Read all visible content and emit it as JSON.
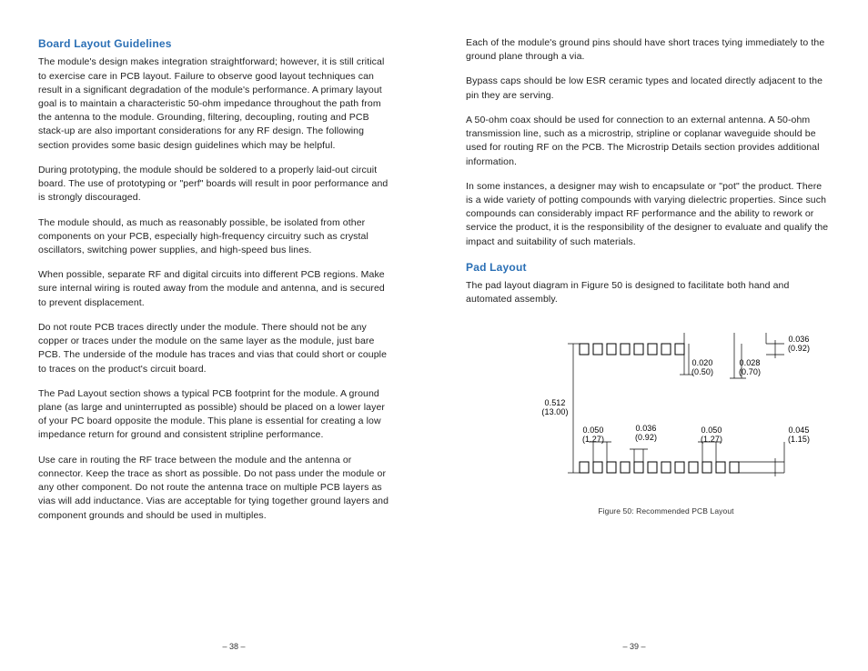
{
  "left": {
    "h1": "Board Layout Guidelines",
    "p1": "The module's design makes integration straightforward; however, it is still critical to exercise care in PCB layout. Failure to observe good layout techniques can result in a significant degradation of the module's performance. A primary layout goal is to maintain a characteristic 50-ohm impedance throughout the path from the antenna to the module. Grounding, filtering, decoupling, routing and PCB stack-up are also important considerations for any RF design. The following section provides some basic design guidelines which may be helpful.",
    "p2": "During prototyping, the module should be soldered to a properly laid-out circuit board. The use of prototyping or \"perf\" boards will result in poor performance and is strongly discouraged.",
    "p3": "The module should, as much as reasonably possible, be isolated from other components on your PCB, especially high-frequency circuitry such as crystal oscillators, switching power supplies, and high-speed bus lines.",
    "p4": "When possible, separate RF and digital circuits into different PCB regions. Make sure internal wiring is routed away from the module and antenna, and is secured to prevent displacement.",
    "p5": "Do not route PCB traces directly under the module. There should not be any copper or traces under the module on the same layer as the module, just bare PCB. The underside of the module has traces and vias that could short or couple to traces on the product's circuit board.",
    "p6": "The Pad Layout section shows a typical PCB footprint for the module. A ground plane (as large and uninterrupted as possible) should be placed on a lower layer of your PC board opposite the module. This plane is essential for creating a low impedance return for ground and consistent stripline performance.",
    "p7": "Use care in routing the RF trace between the module and the antenna or connector. Keep the trace as short as possible. Do not pass under the module or any other component. Do not route the antenna trace on multiple PCB layers as vias will add inductance. Vias are acceptable for tying together ground layers and component grounds and should be used in multiples.",
    "pagenum": "– 38 –"
  },
  "right": {
    "p1": "Each of the module's ground pins should have short traces tying immediately to the ground plane through a via.",
    "p2": "Bypass caps should be low ESR ceramic types and located directly adjacent to the pin they are serving.",
    "p3": "A 50-ohm coax should be used for connection to an external antenna. A 50-ohm transmission line, such as a microstrip, stripline or coplanar waveguide should be used for routing RF on the PCB. The Microstrip Details section provides additional information.",
    "p4": "In some instances, a designer may wish to encapsulate or \"pot\" the product. There is a wide variety of potting compounds with varying dielectric properties. Since such compounds can considerably impact RF performance and the ability to rework or service the product, it is the responsibility of the designer to evaluate and qualify the impact and suitability of such materials.",
    "h2": "Pad Layout",
    "p5": "The pad layout diagram in Figure 50 is designed to facilitate both hand and automated assembly.",
    "figcap": "Figure 50: Recommended PCB Layout",
    "pagenum": "– 39 –"
  },
  "dims": {
    "d1a": "0.020",
    "d1b": "(0.50)",
    "d2a": "0.028",
    "d2b": "(0.70)",
    "d3a": "0.036",
    "d3b": "(0.92)",
    "d4a": "0.512",
    "d4b": "(13.00)",
    "d5a": "0.050",
    "d5b": "(1.27)",
    "d6a": "0.036",
    "d6b": "(0.92)",
    "d7a": "0.050",
    "d7b": "(1.27)",
    "d8a": "0.045",
    "d8b": "(1.15)"
  }
}
